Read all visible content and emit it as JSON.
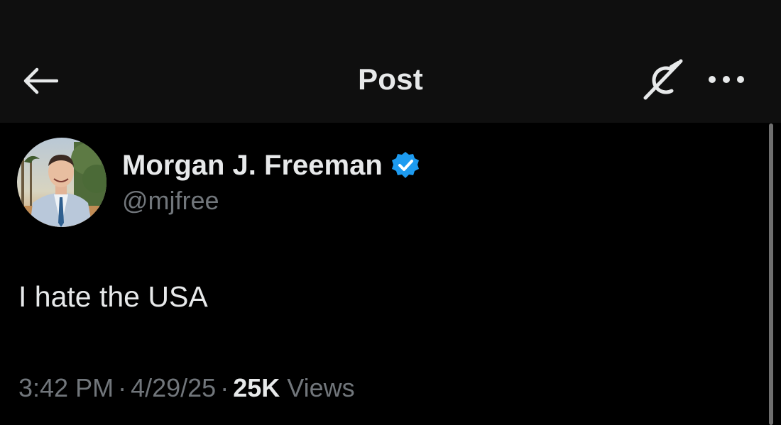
{
  "header": {
    "title": "Post",
    "back_icon": "arrow-left-icon",
    "grok_icon": "grok-icon",
    "more_icon": "more-horizontal-icon"
  },
  "post": {
    "author": {
      "name": "Morgan J. Freeman",
      "handle": "@mjfree",
      "verified": true,
      "verified_icon": "verified-badge-icon"
    },
    "text": "I hate the USA",
    "time": "3:42 PM",
    "date": "4/29/25",
    "views_count": "25K",
    "views_label": "Views",
    "separator": "·"
  },
  "colors": {
    "background": "#000000",
    "header_background": "#0f0f0f",
    "text_primary": "#e7e9ea",
    "text_secondary": "#71767b",
    "verified_blue": "#1d9bf0"
  }
}
